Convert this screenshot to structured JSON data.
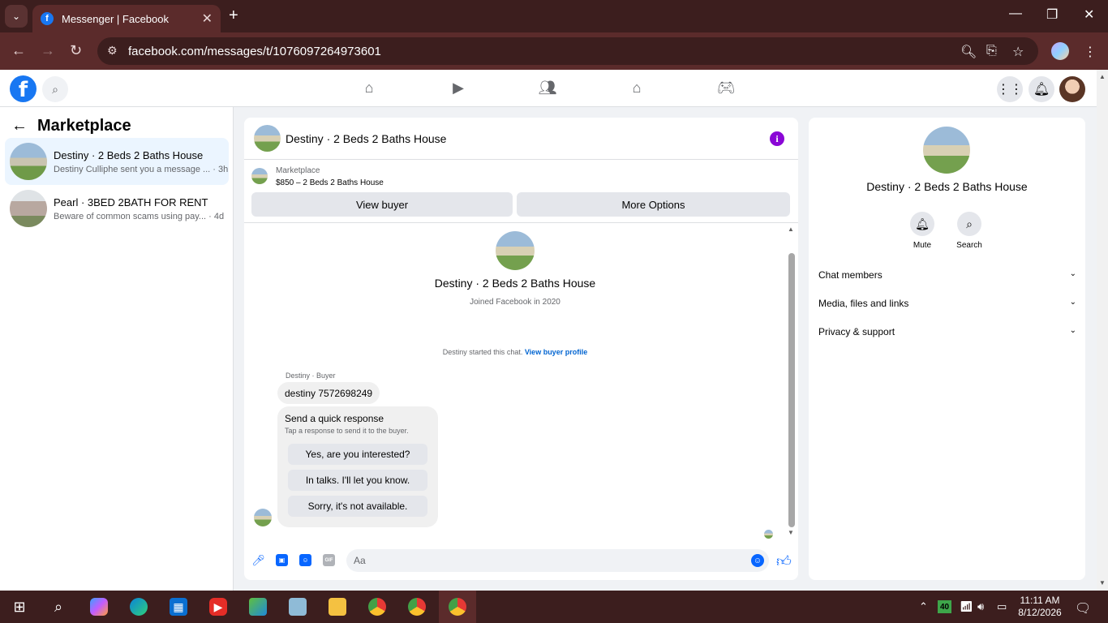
{
  "browser": {
    "tab_title": "Messenger | Facebook",
    "url": "facebook.com/messages/t/1076097264973601"
  },
  "sidebar": {
    "heading": "Marketplace",
    "conversations": [
      {
        "name": "Destiny · 2 Beds 2 Baths House",
        "snippet": "Destiny Culliphe sent you a message ...",
        "time": "· 3h"
      },
      {
        "name": "Pearl · 3BED 2BATH FOR RENT",
        "snippet": "Beware of common scams using pay...",
        "time": "· 4d"
      }
    ]
  },
  "chat": {
    "title": "Destiny · 2 Beds 2 Baths House",
    "listing_label": "Marketplace",
    "listing_detail": "$850 – 2 Beds 2 Baths House",
    "view_buyer_label": "View buyer",
    "more_options_label": "More Options",
    "profile_name": "Destiny · 2 Beds 2 Baths House",
    "joined": "Joined Facebook in 2020",
    "started_text": "Destiny started this chat.",
    "view_buyer_profile": "View buyer profile",
    "sender_label": "Destiny · Buyer",
    "message": "destiny 7572698249",
    "quick_title": "Send a quick response",
    "quick_sub": "Tap a response to send it to the buyer.",
    "quick_responses": [
      "Yes, are you interested?",
      "In talks. I'll let you know.",
      "Sorry, it's not available."
    ],
    "input_placeholder": "Aa"
  },
  "details": {
    "name": "Destiny · 2 Beds 2 Baths House",
    "mute_label": "Mute",
    "search_label": "Search",
    "sections": [
      "Chat members",
      "Media, files and links",
      "Privacy & support"
    ]
  },
  "taskbar": {
    "battery_badge": "40",
    "time": "11:11 AM",
    "date": "8/12/2026"
  },
  "colors": {
    "accent": "#1877f2",
    "info": "#8a06d6",
    "chrome": "#5b2b2b"
  }
}
